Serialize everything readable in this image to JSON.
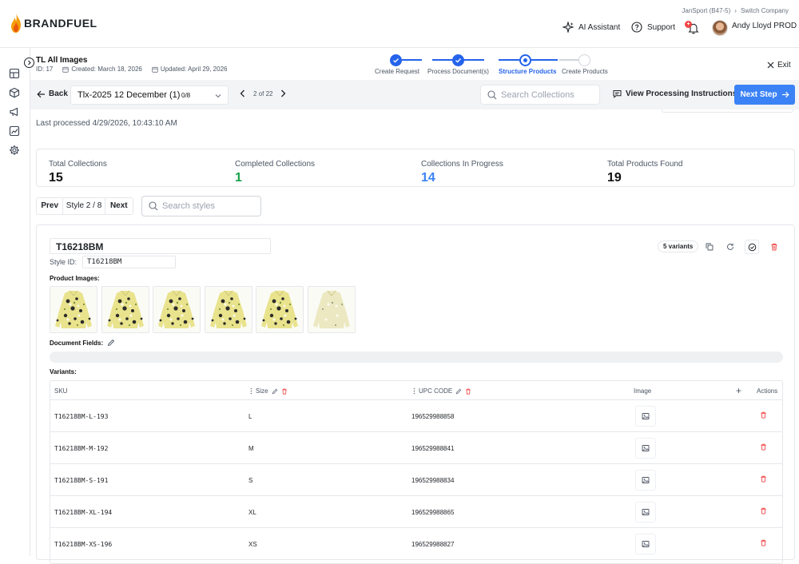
{
  "header": {
    "brand": "BRANDFUEL",
    "company": "JanSport (B47-5)",
    "company_sep": "›",
    "switch_company": "Switch Company",
    "ai_assistant": "AI Assistant",
    "support": "Support",
    "notification_badge": "+",
    "user_name": "Andy Lloyd PROD"
  },
  "document": {
    "title": "TL All Images",
    "id": "ID: 17",
    "created": "Created: March 18, 2026",
    "updated": "Updated: April 29, 2026",
    "last_processed": "Last processed 4/29/2026, 10:43:10 AM"
  },
  "stepper": {
    "steps": [
      {
        "label": "Create Request",
        "state": "done"
      },
      {
        "label": "Process Document(s)",
        "state": "done"
      },
      {
        "label": "Structure Products",
        "state": "current"
      },
      {
        "label": "Create Products",
        "state": "upcoming"
      }
    ],
    "accent": "#2563eb"
  },
  "exit_label": "Exit",
  "toolbar": {
    "back_label": "Back",
    "document_name": "Tlx-2025 12 December (1)",
    "document_progress": "0/8",
    "pager_text": "2 of 22",
    "collection_search_placeholder": "Search Collections",
    "view_instructions_label": "View Processing Instructions",
    "next_step_label": "Next Step"
  },
  "stats": [
    {
      "label": "Total Collections",
      "value": "15",
      "color": "#111111"
    },
    {
      "label": "Completed Collections",
      "value": "1",
      "color": "#16a34a"
    },
    {
      "label": "Collections In Progress",
      "value": "14",
      "color": "#3b82f6"
    },
    {
      "label": "Total Products Found",
      "value": "19",
      "color": "#111111"
    }
  ],
  "style_nav": {
    "prev_label": "Prev",
    "position": "Style 2 / 8",
    "next_label": "Next",
    "search_placeholder": "Search styles"
  },
  "style_card": {
    "name": "T16218BM",
    "style_id_label": "Style ID:",
    "style_id_value": "T16218BM",
    "variants_badge": "5 variants",
    "product_images_label": "Product Images:",
    "image_count": 6,
    "document_fields_label": "Document Fields:",
    "variants_label": "Variants:"
  },
  "variants_table": {
    "headers": {
      "sku": "SKU",
      "size": "Size",
      "upc": "UPC CODE",
      "image": "Image",
      "add": "+",
      "actions": "Actions"
    },
    "rows": [
      {
        "sku": "T16218BM-L-193",
        "size": "L",
        "upc": "196529988858"
      },
      {
        "sku": "T16218BM-M-192",
        "size": "M",
        "upc": "196529988841"
      },
      {
        "sku": "T16218BM-S-191",
        "size": "S",
        "upc": "196529988834"
      },
      {
        "sku": "T16218BM-XL-194",
        "size": "XL",
        "upc": "196529988865"
      },
      {
        "sku": "T16218BM-XS-196",
        "size": "XS",
        "upc": "196529988827"
      }
    ]
  },
  "colors": {
    "primary": "#3b82f6",
    "danger": "#ef4444",
    "success": "#16a34a"
  }
}
